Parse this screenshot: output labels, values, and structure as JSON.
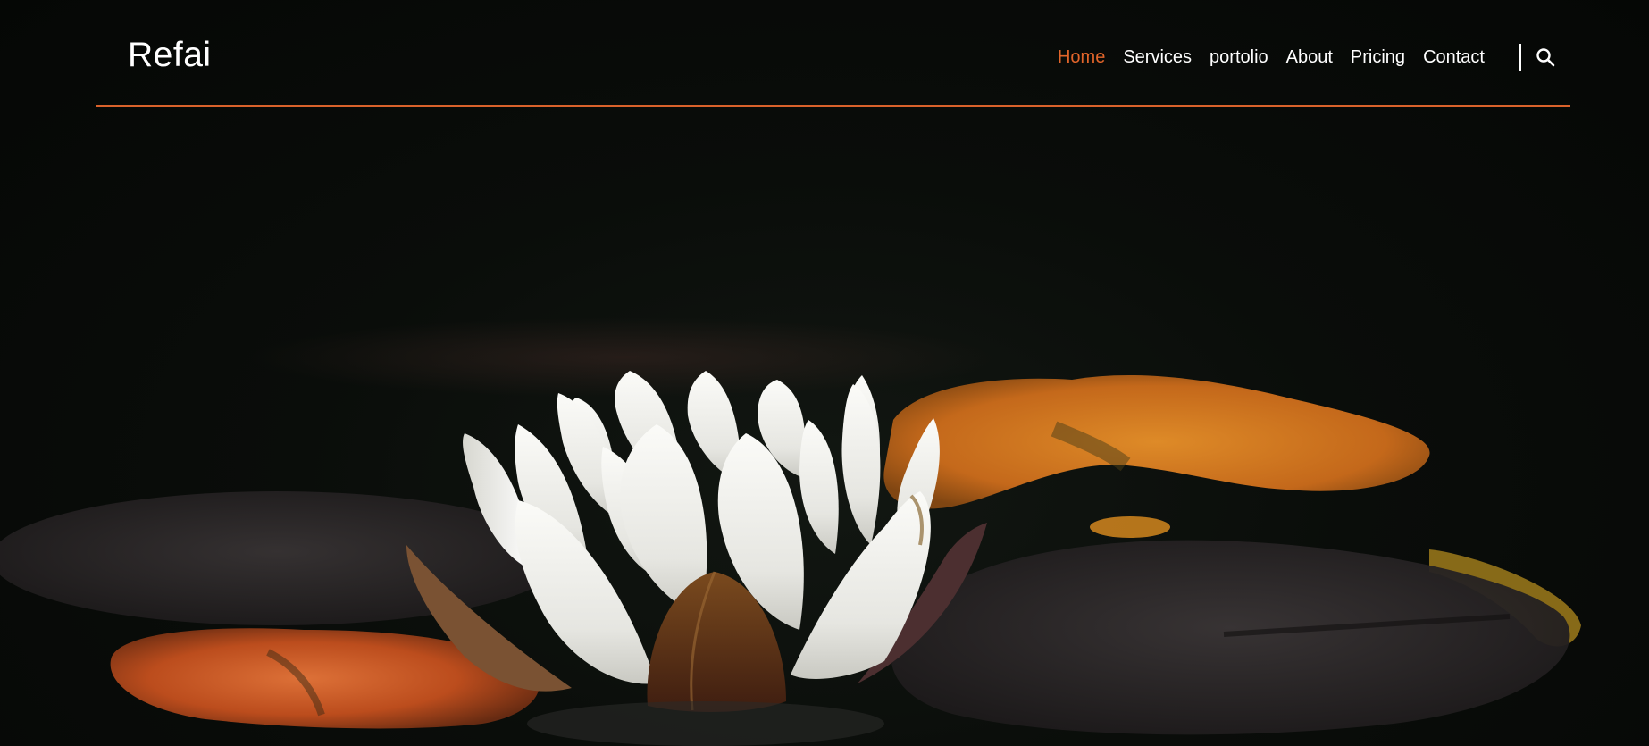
{
  "brand": {
    "name": "Refai"
  },
  "nav": {
    "items": [
      {
        "label": "Home",
        "active": true
      },
      {
        "label": "Services",
        "active": false
      },
      {
        "label": "portolio",
        "active": false
      },
      {
        "label": "About",
        "active": false
      },
      {
        "label": "Pricing",
        "active": false
      },
      {
        "label": "Contact",
        "active": false
      }
    ],
    "search_icon": "search-icon"
  },
  "hero": {
    "image": "water-lily-on-dark-pond"
  },
  "colors": {
    "accent": "#e0642a",
    "nav_text": "#ffffff",
    "background": "#070907",
    "rule": "#d9622b"
  }
}
